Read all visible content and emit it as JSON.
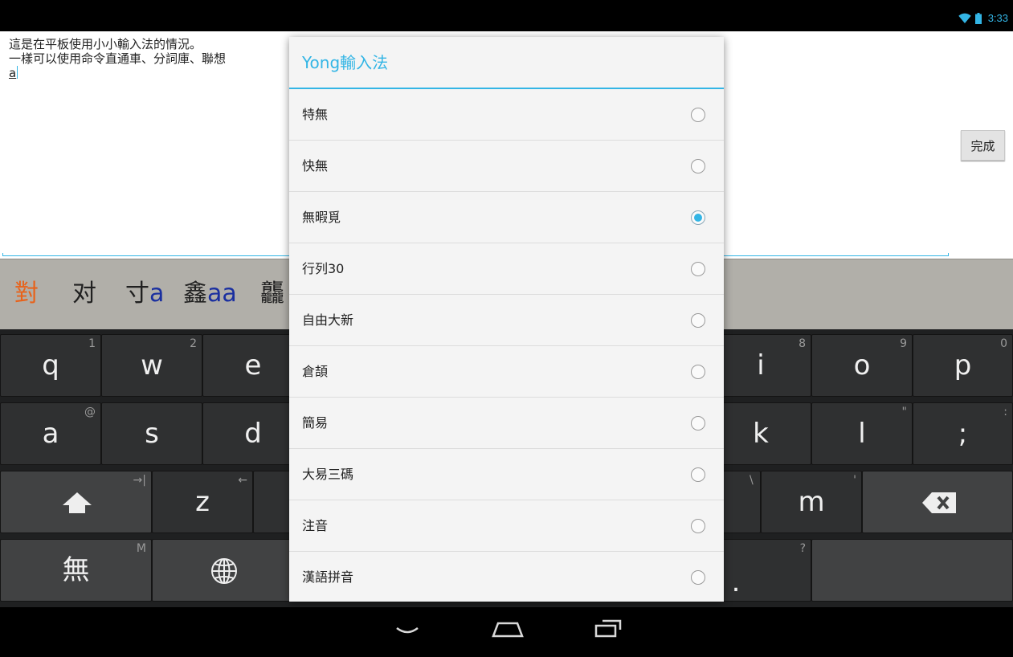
{
  "status_bar": {
    "time": "3:33"
  },
  "editor": {
    "lines": [
      "這是在平板使用小小輸入法的情況。",
      "一樣可以使用命令直通車、分詞庫、聯想",
      "a"
    ],
    "done_label": "完成"
  },
  "candidates": [
    "對",
    "对",
    "寸",
    "a",
    "鑫",
    "aa",
    "龘"
  ],
  "keyboard": {
    "row1": [
      {
        "main": "q",
        "hint": "1"
      },
      {
        "main": "w",
        "hint": "2"
      },
      {
        "main": "e",
        "hint": ""
      },
      {
        "main": "i",
        "hint": "8"
      },
      {
        "main": "o",
        "hint": "9"
      },
      {
        "main": "p",
        "hint": "0"
      }
    ],
    "row2": [
      {
        "main": "a",
        "hint": "@"
      },
      {
        "main": "s",
        "hint": ""
      },
      {
        "main": "d",
        "hint": ""
      },
      {
        "main": "k",
        "hint": ""
      },
      {
        "main": "l",
        "hint": "\""
      },
      {
        "main": ";",
        "hint": ":"
      }
    ],
    "row3": [
      {
        "main": "z",
        "hint": "←"
      },
      {
        "main": "m",
        "hint": "'"
      }
    ],
    "shift_hint": "→|",
    "row3_backslash_hint": "\\",
    "mode_key": "無",
    "mode_hint": "M",
    "period_key": ".",
    "period_hint": "?"
  },
  "dialog": {
    "title": "Yong輸入法",
    "options": [
      {
        "label": "特無",
        "checked": false
      },
      {
        "label": "快無",
        "checked": false
      },
      {
        "label": "無暇覓",
        "checked": true
      },
      {
        "label": "行列30",
        "checked": false
      },
      {
        "label": "自由大新",
        "checked": false
      },
      {
        "label": "倉頡",
        "checked": false
      },
      {
        "label": "簡易",
        "checked": false
      },
      {
        "label": "大易三碼",
        "checked": false
      },
      {
        "label": "注音",
        "checked": false
      },
      {
        "label": "漢語拼音",
        "checked": false
      }
    ]
  },
  "colors": {
    "accent": "#33b5e5",
    "candidate_highlight": "#e8621a",
    "candidate_latin": "#1a2fa0"
  },
  "icons": [
    "wifi-icon",
    "battery-icon",
    "shift-icon",
    "backspace-icon",
    "globe-icon",
    "nav-back-icon",
    "nav-home-icon",
    "nav-recents-icon"
  ]
}
